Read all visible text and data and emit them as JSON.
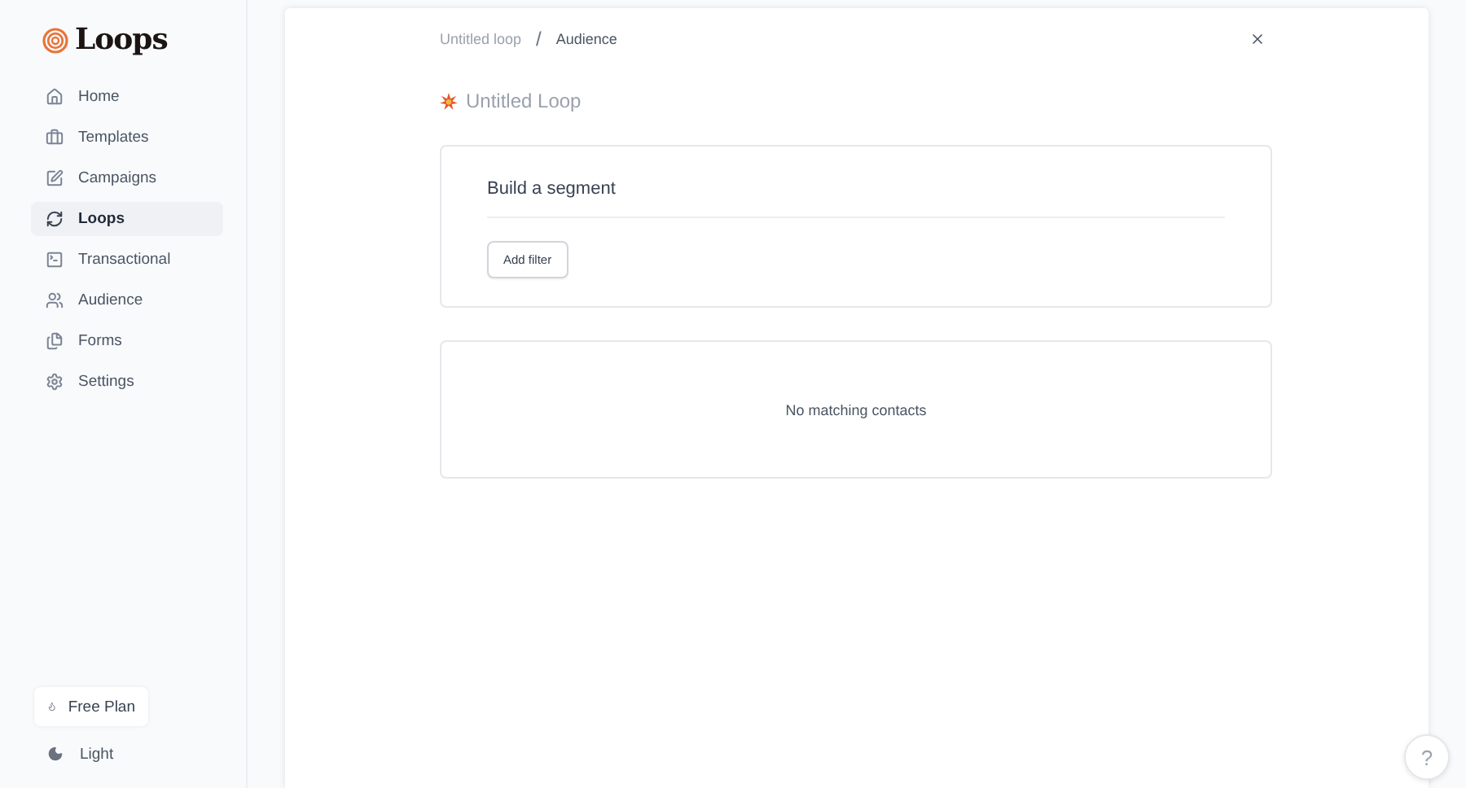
{
  "sidebar": {
    "logo": "Loops",
    "items": [
      {
        "label": "Home",
        "selected": false
      },
      {
        "label": "Templates",
        "selected": false
      },
      {
        "label": "Campaigns",
        "selected": false
      },
      {
        "label": "Loops",
        "selected": true
      },
      {
        "label": "Transactional",
        "selected": false
      },
      {
        "label": "Audience",
        "selected": false
      },
      {
        "label": "Forms",
        "selected": false
      },
      {
        "label": "Settings",
        "selected": false
      }
    ],
    "plan_button": "Free Plan",
    "theme_toggle": "Light"
  },
  "breadcrumb": {
    "parent": "Untitled loop",
    "separator": "/",
    "current": "Audience"
  },
  "title": {
    "placeholder": "Untitled Loop"
  },
  "segment": {
    "heading": "Build a segment",
    "add_filter": "Add filter"
  },
  "results": {
    "empty_message": "No matching contacts"
  },
  "help_button": "?"
}
